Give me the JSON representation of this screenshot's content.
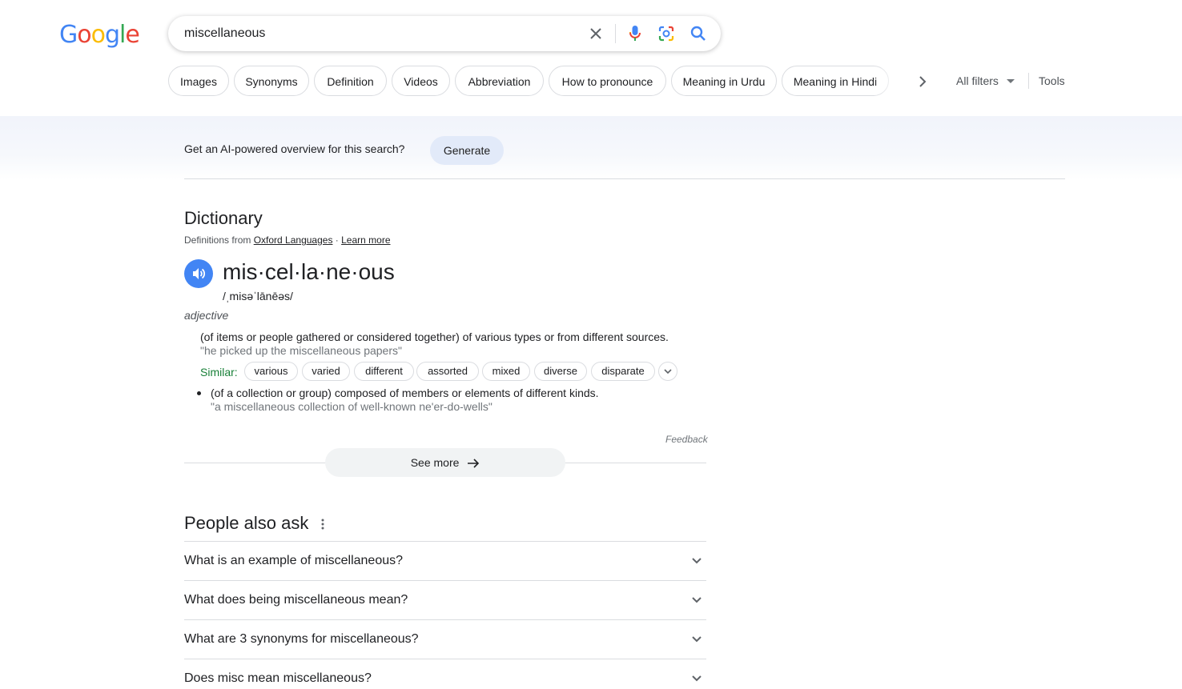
{
  "logo": {
    "text": "Google"
  },
  "search": {
    "query": "miscellaneous"
  },
  "chips": [
    "Images",
    "Synonyms",
    "Definition",
    "Videos",
    "Abbreviation",
    "How to pronounce",
    "Meaning in Urdu",
    "Meaning in Hindi"
  ],
  "toolbar": {
    "all_filters": "All filters",
    "tools": "Tools"
  },
  "ai": {
    "prompt": "Get an AI-powered overview for this search?",
    "button": "Generate"
  },
  "dictionary": {
    "title": "Dictionary",
    "source_prefix": "Definitions from ",
    "source_link": "Oxford Languages",
    "source_sep": " · ",
    "learn_more": "Learn more",
    "headword": "mis·cel·la·ne·ous",
    "phonetic": "/ˌmisəˈlānēəs/",
    "part_of_speech": "adjective",
    "definition_1": "(of items or people gathered or considered together) of various types or from different sources.",
    "example_1": "\"he picked up the miscellaneous papers\"",
    "similar_label": "Similar:",
    "similar": [
      "various",
      "varied",
      "different",
      "assorted",
      "mixed",
      "diverse",
      "disparate"
    ],
    "definition_2": "(of a collection or group) composed of members or elements of different kinds.",
    "example_2": "\"a miscellaneous collection of well-known ne'er-do-wells\"",
    "feedback": "Feedback",
    "see_more": "See more"
  },
  "people_also_ask": {
    "title": "People also ask",
    "questions": [
      "What is an example of miscellaneous?",
      "What does being miscellaneous mean?",
      "What are 3 synonyms for miscellaneous?",
      "Does misc mean miscellaneous?"
    ]
  }
}
